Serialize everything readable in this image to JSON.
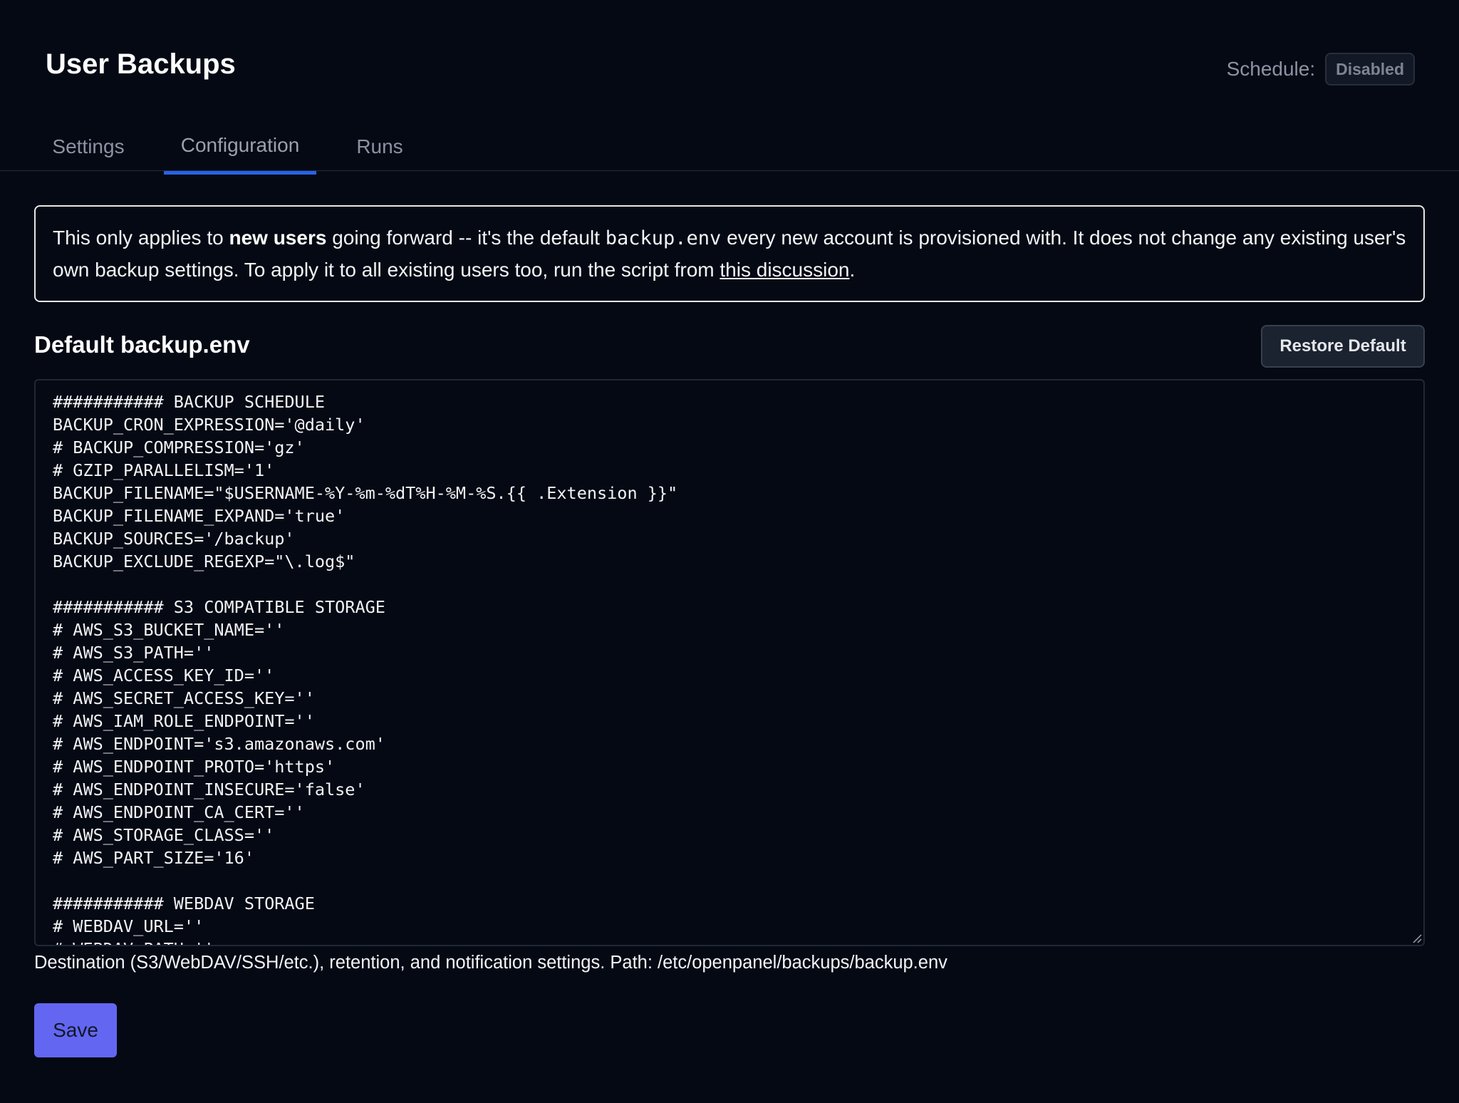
{
  "header": {
    "title": "User Backups",
    "schedule_label": "Schedule:",
    "schedule_status": "Disabled"
  },
  "tabs": [
    {
      "label": "Settings",
      "active": false
    },
    {
      "label": "Configuration",
      "active": true
    },
    {
      "label": "Runs",
      "active": false
    }
  ],
  "notice": {
    "part1": "This only applies to ",
    "bold": "new users",
    "part2": " going forward -- it's the default ",
    "code": "backup.env",
    "part3": " every new account is provisioned with. It does not change any existing user's own backup settings. To apply it to all existing users too, run the script from ",
    "link": "this discussion",
    "part4": "."
  },
  "section": {
    "title": "Default backup.env",
    "restore_label": "Restore Default"
  },
  "editor": {
    "content": "########### BACKUP SCHEDULE\nBACKUP_CRON_EXPRESSION='@daily'\n# BACKUP_COMPRESSION='gz'\n# GZIP_PARALLELISM='1'\nBACKUP_FILENAME=\"$USERNAME-%Y-%m-%dT%H-%M-%S.{{ .Extension }}\"\nBACKUP_FILENAME_EXPAND='true'\nBACKUP_SOURCES='/backup'\nBACKUP_EXCLUDE_REGEXP=\"\\.log$\"\n\n########### S3 COMPATIBLE STORAGE\n# AWS_S3_BUCKET_NAME=''\n# AWS_S3_PATH=''\n# AWS_ACCESS_KEY_ID=''\n# AWS_SECRET_ACCESS_KEY=''\n# AWS_IAM_ROLE_ENDPOINT=''\n# AWS_ENDPOINT='s3.amazonaws.com'\n# AWS_ENDPOINT_PROTO='https'\n# AWS_ENDPOINT_INSECURE='false'\n# AWS_ENDPOINT_CA_CERT=''\n# AWS_STORAGE_CLASS=''\n# AWS_PART_SIZE='16'\n\n########### WEBDAV STORAGE\n# WEBDAV_URL=''\n# WEBDAV_PATH=''"
  },
  "hint": "Destination (S3/WebDAV/SSH/etc.), retention, and notification settings. Path: /etc/openpanel/backups/backup.env",
  "actions": {
    "save_label": "Save"
  },
  "colors": {
    "background": "#050914",
    "tab_accent": "#2563eb",
    "save_button": "#6366f1"
  }
}
